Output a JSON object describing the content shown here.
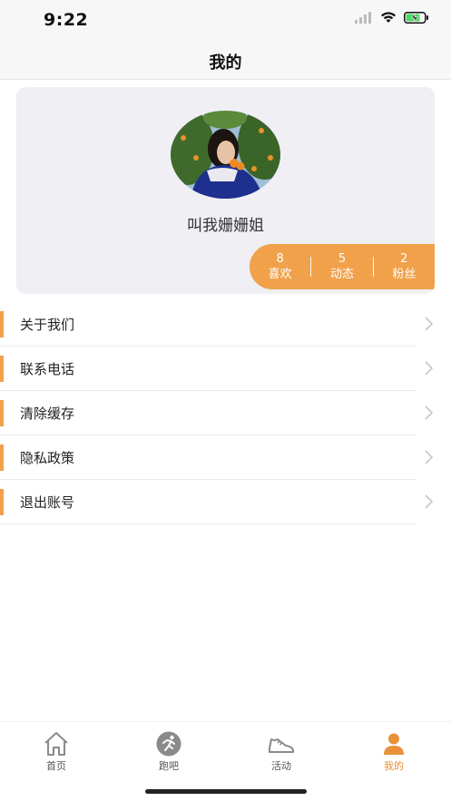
{
  "status_bar": {
    "time": "9:22"
  },
  "nav": {
    "title": "我的"
  },
  "profile": {
    "username": "叫我姗姗姐",
    "stats": [
      {
        "value": "8",
        "label": "喜欢"
      },
      {
        "value": "5",
        "label": "动态"
      },
      {
        "value": "2",
        "label": "粉丝"
      }
    ]
  },
  "menu": {
    "items": [
      {
        "label": "关于我们"
      },
      {
        "label": "联系电话"
      },
      {
        "label": "清除缓存"
      },
      {
        "label": "隐私政策"
      },
      {
        "label": "退出账号"
      }
    ]
  },
  "tab_bar": {
    "tabs": [
      {
        "label": "首页",
        "icon": "home-icon"
      },
      {
        "label": "跑吧",
        "icon": "runner-icon"
      },
      {
        "label": "活动",
        "icon": "shoe-icon"
      },
      {
        "label": "我的",
        "icon": "person-icon",
        "active": true
      }
    ]
  },
  "colors": {
    "accent": "#f0a14a",
    "active_tab": "#e8913a",
    "card_bg": "#efeff4"
  }
}
